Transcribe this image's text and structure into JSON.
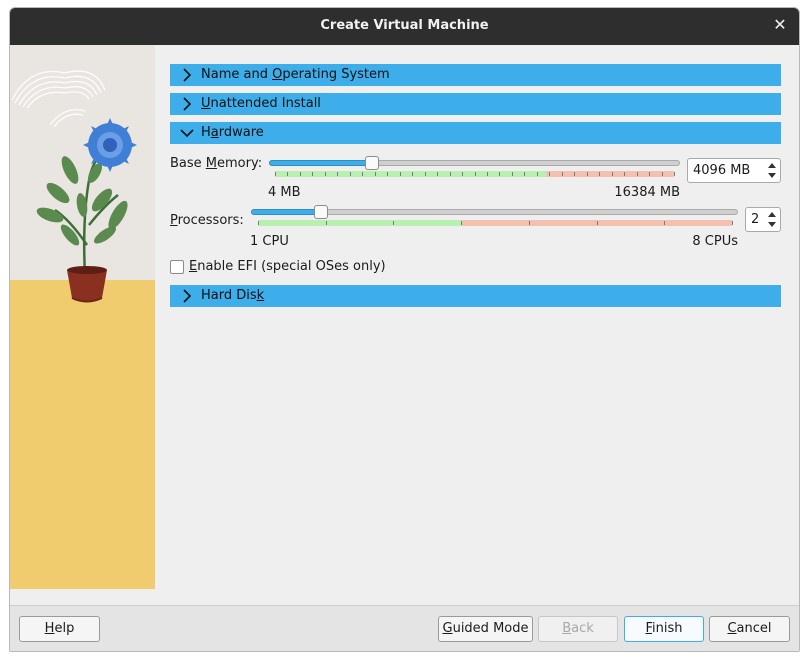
{
  "window": {
    "title": "Create Virtual Machine",
    "close_glyph": "✕"
  },
  "sections": {
    "name_os": {
      "pre": "Name and ",
      "key": "O",
      "post": "perating System",
      "expanded": false
    },
    "unattended": {
      "pre": "",
      "key": "U",
      "post": "nattended Install",
      "expanded": false
    },
    "hardware": {
      "pre": "H",
      "key": "a",
      "post": "rdware",
      "expanded": true
    },
    "hard_disk": {
      "pre": "Hard Dis",
      "key": "k",
      "post": "",
      "expanded": false
    }
  },
  "hardware": {
    "memory": {
      "label_pre": "Base ",
      "label_key": "M",
      "label_post": "emory:",
      "value": "4096 MB",
      "min_label": "4 MB",
      "max_label": "16384 MB",
      "min": 4,
      "max": 16384,
      "current": 4096,
      "recommended_max_fraction": 0.68
    },
    "processors": {
      "label_pre": "",
      "label_key": "P",
      "label_post": "rocessors:",
      "value": "2",
      "min_label": "1 CPU",
      "max_label": "8 CPUs",
      "min": 1,
      "max": 8,
      "current": 2,
      "recommended_max_fraction": 0.43
    },
    "efi": {
      "label_key": "E",
      "label_post": "nable EFI (special OSes only)",
      "checked": false
    }
  },
  "footer": {
    "help": {
      "key": "H",
      "post": "elp"
    },
    "guided": {
      "key": "G",
      "post": "uided Mode"
    },
    "back": {
      "key": "B",
      "post": "ack"
    },
    "finish": {
      "key": "F",
      "post": "inish"
    },
    "cancel": {
      "key": "C",
      "post": "ancel"
    }
  },
  "colors": {
    "accent": "#3daee9",
    "titlebar": "#2e2e2e",
    "recommended": "#b8f0b0",
    "over_limit": "#f4c0b0",
    "art_floor": "#f0cc6e"
  },
  "icons": {
    "section_collapsed": "chevron-right-icon",
    "section_expanded": "chevron-down-icon",
    "close": "close-icon",
    "spin": "spin-arrows-icon"
  }
}
